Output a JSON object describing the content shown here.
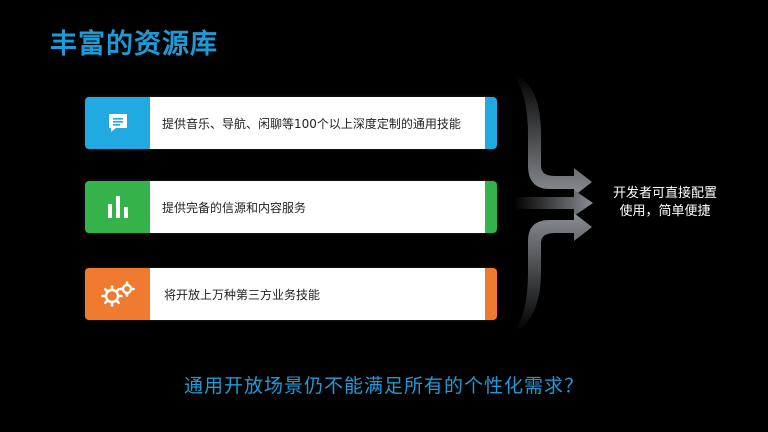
{
  "title": "丰富的资源库",
  "cards": [
    {
      "text": "提供音乐、导航、闲聊等100个以上深度定制的通用技能",
      "icon": "chat-bubble-icon"
    },
    {
      "text": "提供完备的信源和内容服务",
      "icon": "bar-chart-icon"
    },
    {
      "text": "将开放上万种第三方业务技能",
      "icon": "gears-icon"
    }
  ],
  "result_text": {
    "line1": "开发者可直接配置",
    "line2": "使用，简单便捷"
  },
  "question": "通用开放场景仍不能满足所有的个性化需求？",
  "colors": {
    "title": "#1e9bd7",
    "card1": "#21a9e1",
    "card2": "#36b24a",
    "card3": "#ef7a30"
  }
}
